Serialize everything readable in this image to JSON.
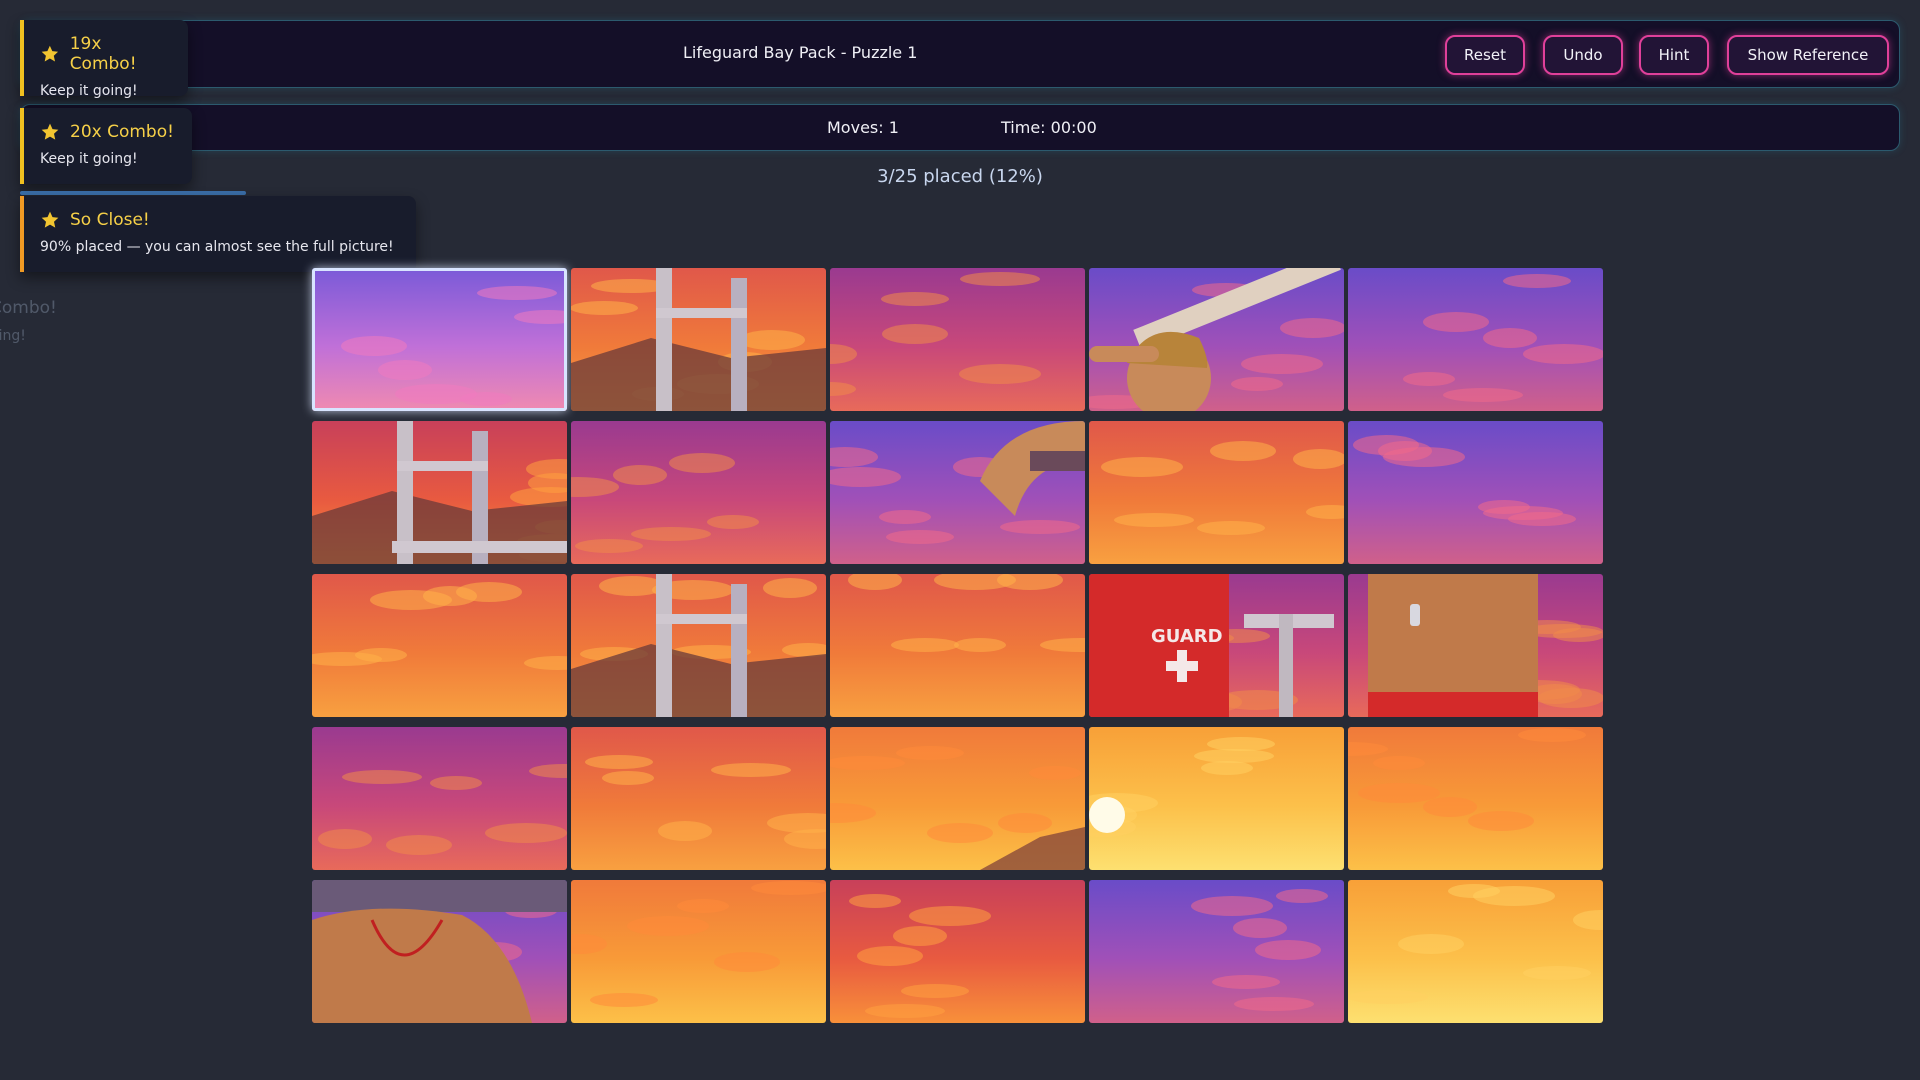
{
  "header": {
    "title": "Lifeguard Bay Pack - Puzzle 1",
    "buttons": {
      "reset": "Reset",
      "undo": "Undo",
      "hint": "Hint",
      "show_reference": "Show Reference"
    }
  },
  "stats": {
    "moves": "Moves: 1",
    "time": "Time: 00:00"
  },
  "progress": {
    "text": "3/25 placed (12%)",
    "placed": 3,
    "total": 25
  },
  "toasts": [
    {
      "title": "19x Combo!",
      "message": "Keep it going!",
      "icon": "star-icon"
    },
    {
      "title": "20x Combo!",
      "message": "Keep it going!",
      "icon": "star-icon"
    },
    {
      "title": "So Close!",
      "message": "90% placed — you can almost see the full picture!",
      "icon": "star-icon"
    }
  ],
  "ghost_toast": {
    "title": "Combo!",
    "message": "oing!"
  },
  "board": {
    "rows": 5,
    "cols": 5,
    "selected_tile": 0,
    "tiles": [
      {
        "sky": "purple",
        "content": "clouds"
      },
      {
        "sky": "orange",
        "content": "tower-frame"
      },
      {
        "sky": "magenta",
        "content": "clouds"
      },
      {
        "sky": "violet",
        "content": "lifeguard-head"
      },
      {
        "sky": "violet",
        "content": "clouds"
      },
      {
        "sky": "red-orange",
        "content": "tower-top"
      },
      {
        "sky": "magenta",
        "content": "clouds"
      },
      {
        "sky": "violet",
        "content": "lifeguard-arm"
      },
      {
        "sky": "orange",
        "content": "clouds"
      },
      {
        "sky": "violet",
        "content": "clouds"
      },
      {
        "sky": "orange",
        "content": "clouds"
      },
      {
        "sky": "orange",
        "content": "legs"
      },
      {
        "sky": "orange",
        "content": "clouds"
      },
      {
        "sky": "magenta",
        "content": "guard-shorts"
      },
      {
        "sky": "magenta",
        "content": "torso-whistle"
      },
      {
        "sky": "magenta",
        "content": "clouds"
      },
      {
        "sky": "orange",
        "content": "clouds"
      },
      {
        "sky": "amber",
        "content": "hill"
      },
      {
        "sky": "gold",
        "content": "sun"
      },
      {
        "sky": "amber",
        "content": "clouds"
      },
      {
        "sky": "violet",
        "content": "lifeguard-chest"
      },
      {
        "sky": "amber",
        "content": "clouds"
      },
      {
        "sky": "red-orange",
        "content": "clouds"
      },
      {
        "sky": "violet",
        "content": "clouds"
      },
      {
        "sky": "gold",
        "content": "clouds"
      }
    ],
    "shorts_text": "GUARD"
  }
}
